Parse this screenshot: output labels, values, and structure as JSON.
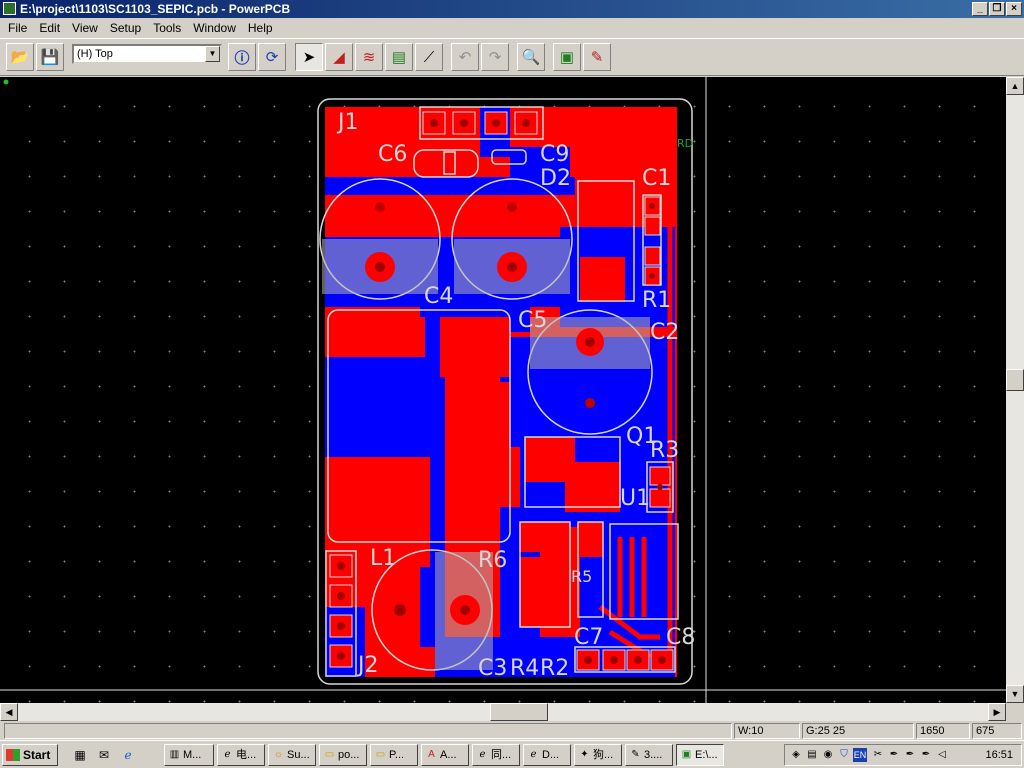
{
  "window": {
    "title": "E:\\project\\1103\\SC1103_SEPIC.pcb - PowerPCB"
  },
  "menu": [
    "File",
    "Edit",
    "View",
    "Setup",
    "Tools",
    "Window",
    "Help"
  ],
  "toolbar": {
    "layer_value": "(H) Top"
  },
  "pcb": {
    "ref_labels": [
      "J1",
      "C6",
      "C9",
      "D2",
      "C1",
      "R1",
      "C4",
      "C5",
      "C2",
      "Q1",
      "R3",
      "U1",
      "L1",
      "R6",
      "R5",
      "C7",
      "C8",
      "J2",
      "C3",
      "R4",
      "R2"
    ],
    "side_label": "RD"
  },
  "status": {
    "width": "W:10",
    "grid": "G:25 25",
    "x": "1650",
    "y": "675"
  },
  "taskbar": {
    "start": "Start",
    "tasks": [
      "M...",
      "电...",
      "Su...",
      "po...",
      "P...",
      "A...",
      "同...",
      "D...",
      "狗...",
      "3....",
      "E:\\..."
    ],
    "clock": "16:51",
    "lang": "EN"
  },
  "colors": {
    "top_copper": "#ff0000",
    "bottom_copper": "#0000ff",
    "silkscreen": "#d8d8d8",
    "title_bar": "#0a246a"
  }
}
